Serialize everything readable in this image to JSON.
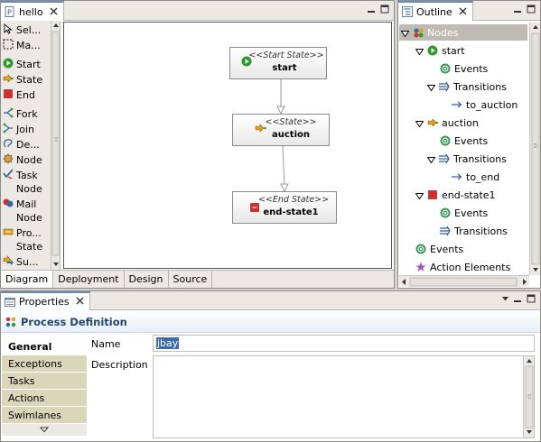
{
  "editor": {
    "tab_label": "hello",
    "palette": [
      {
        "icon": "select-arrow-icon",
        "label": "Sel..."
      },
      {
        "icon": "marquee-icon",
        "label": "Ma..."
      },
      {
        "icon": "start-state-icon",
        "label": "Start"
      },
      {
        "icon": "state-icon",
        "label": "State"
      },
      {
        "icon": "end-state-icon",
        "label": "End"
      },
      {
        "icon": "fork-icon",
        "label": "Fork"
      },
      {
        "icon": "join-icon",
        "label": "Join"
      },
      {
        "icon": "decision-icon",
        "label": "De..."
      },
      {
        "icon": "node-icon",
        "label": "Node"
      },
      {
        "icon": "task-node-icon",
        "label": "Task\nNode"
      },
      {
        "icon": "mail-node-icon",
        "label": "Mail\nNode"
      },
      {
        "icon": "process-state-icon",
        "label": "Pro...\nState"
      },
      {
        "icon": "super-state-icon",
        "label": "Su...\nState"
      }
    ],
    "nodes": {
      "start": {
        "stereotype": "<<Start State>>",
        "name": "start"
      },
      "auction": {
        "stereotype": "<<State>>",
        "name": "auction"
      },
      "end": {
        "stereotype": "<<End State>>",
        "name": "end-state1"
      }
    },
    "bottom_tabs": [
      "Diagram",
      "Deployment",
      "Design",
      "Source"
    ]
  },
  "outline": {
    "tab_label": "Outline",
    "tree": [
      {
        "label": "Nodes",
        "icon": "nodes-icon",
        "depth": 0,
        "expanded": true,
        "selected": true
      },
      {
        "label": "start",
        "icon": "start-state-icon",
        "depth": 1,
        "expanded": true
      },
      {
        "label": "Events",
        "icon": "events-icon",
        "depth": 2
      },
      {
        "label": "Transitions",
        "icon": "transitions-icon",
        "depth": 2,
        "expanded": true
      },
      {
        "label": "to_auction",
        "icon": "transition-arrow-icon",
        "depth": 3
      },
      {
        "label": "auction",
        "icon": "state-icon",
        "depth": 1,
        "expanded": true
      },
      {
        "label": "Events",
        "icon": "events-icon",
        "depth": 2
      },
      {
        "label": "Transitions",
        "icon": "transitions-icon",
        "depth": 2,
        "expanded": true
      },
      {
        "label": "to_end",
        "icon": "transition-arrow-icon",
        "depth": 3
      },
      {
        "label": "end-state1",
        "icon": "end-state-icon",
        "depth": 1,
        "expanded": true
      },
      {
        "label": "Events",
        "icon": "events-icon",
        "depth": 2
      },
      {
        "label": "Transitions",
        "icon": "transitions-icon",
        "depth": 2
      },
      {
        "label": "Events",
        "icon": "events-icon",
        "depth": 0
      },
      {
        "label": "Action Elements",
        "icon": "action-elements-icon",
        "depth": 0
      }
    ]
  },
  "properties": {
    "tab_label": "Properties",
    "header": "Process Definition",
    "sections": [
      "General",
      "Exceptions",
      "Tasks",
      "Actions",
      "Swimlanes"
    ],
    "active_section": "General",
    "name_label": "Name",
    "name_value": "jbay",
    "description_label": "Description",
    "description_value": ""
  },
  "colors": {
    "selection": "#6b8ab6",
    "side_tab": "#dad6b9",
    "start_green": "#2e9a2e",
    "end_red": "#d62d2d",
    "state_orange": "#e0a020"
  }
}
